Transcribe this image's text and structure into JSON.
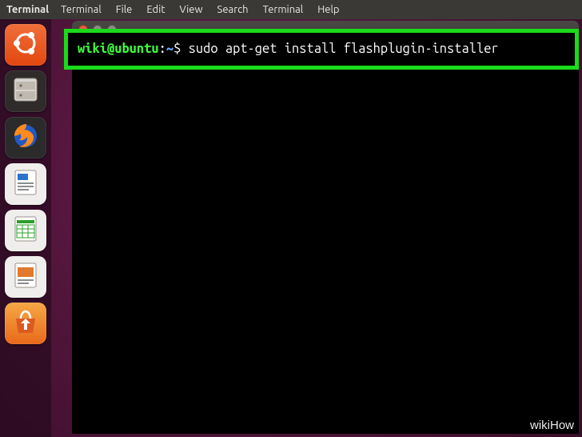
{
  "menubar": {
    "app_label": "Terminal",
    "items": [
      "Terminal",
      "File",
      "Edit",
      "View",
      "Search",
      "Terminal",
      "Help"
    ]
  },
  "launcher": {
    "items": [
      {
        "name": "ubuntu-dash-icon"
      },
      {
        "name": "files-icon"
      },
      {
        "name": "firefox-icon"
      },
      {
        "name": "writer-icon"
      },
      {
        "name": "calc-icon"
      },
      {
        "name": "impress-icon"
      },
      {
        "name": "software-center-icon"
      }
    ]
  },
  "terminal": {
    "prompt_user": "wiki@ubuntu",
    "prompt_sep": ":",
    "prompt_path": "~",
    "prompt_symbol": "$",
    "command": "sudo apt-get install flashplugin-installer"
  },
  "watermark": "wikiHow"
}
